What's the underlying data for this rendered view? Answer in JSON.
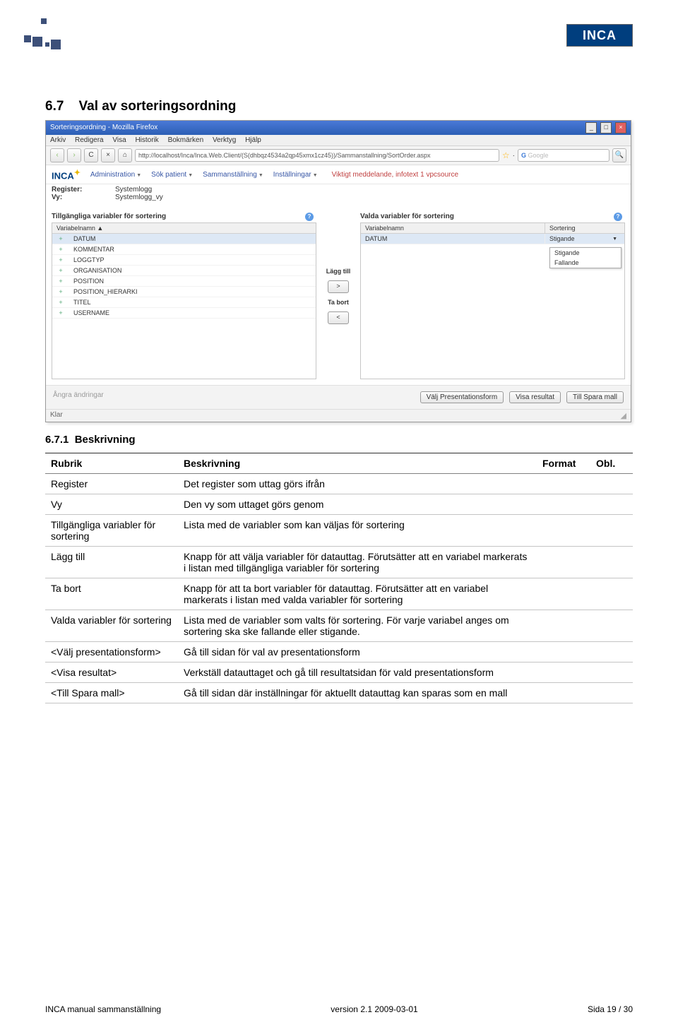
{
  "section_number": "6.7",
  "section_title": "Val av sorteringsordning",
  "subsection_number": "6.7.1",
  "subsection_title": "Beskrivning",
  "logo_text": "INCA",
  "screenshot": {
    "window_title": "Sorteringsordning - Mozilla Firefox",
    "win_min": "_",
    "win_max": "□",
    "win_close": "×",
    "menu": [
      "Arkiv",
      "Redigera",
      "Visa",
      "Historik",
      "Bokmärken",
      "Verktyg",
      "Hjälp"
    ],
    "nav_back": "‹",
    "nav_fwd": "›",
    "nav_reload": "C",
    "nav_stop": "×",
    "nav_home": "⌂",
    "url": "http://localhost/Inca/Inca.Web.Client/(S(dhbqz4534a2qp45xmx1cz45))/Sammanstallning/SortOrder.aspx",
    "star": "☆",
    "search_engine": "G",
    "search_placeholder": "Google",
    "search_go": "🔍",
    "app_logo": "INCA",
    "app_logo_star": "✦",
    "app_menu": [
      "Administration",
      "Sök patient",
      "Sammanställning",
      "Inställningar"
    ],
    "app_notice": "Viktigt meddelande, infotext 1 vpcsource",
    "meta": {
      "register_lbl": "Register:",
      "register_val": "Systemlogg",
      "vy_lbl": "Vy:",
      "vy_val": "Systemlogg_vy"
    },
    "left_panel": {
      "title": "Tillgängliga variabler för sortering",
      "header": "Variabelnamn ▲",
      "rows": [
        "DATUM",
        "KOMMENTAR",
        "LOGGTYP",
        "ORGANISATION",
        "POSITION",
        "POSITION_HIERARKI",
        "TITEL",
        "USERNAME"
      ]
    },
    "mid": {
      "add_lbl": "Lägg till",
      "add_btn": ">",
      "remove_lbl": "Ta bort",
      "remove_btn": "<"
    },
    "right_panel": {
      "title": "Valda variabler för sortering",
      "header_name": "Variabelnamn",
      "header_sort": "Sortering",
      "row_name": "DATUM",
      "row_sort": "Stigande",
      "dropdown": [
        "Stigande",
        "Fallande"
      ]
    },
    "bottom": {
      "ghost": "Ångra ändringar",
      "btn1": "Välj Presentationsform",
      "btn2": "Visa resultat",
      "btn3": "Till Spara mall"
    },
    "status": "Klar"
  },
  "table": {
    "headers": {
      "rubrik": "Rubrik",
      "beskrivning": "Beskrivning",
      "format": "Format",
      "obl": "Obl."
    },
    "rows": [
      {
        "rubrik": "Register",
        "beskrivning": "Det register som uttag görs ifrån"
      },
      {
        "rubrik": "Vy",
        "beskrivning": "Den vy som uttaget görs genom"
      },
      {
        "rubrik": "Tillgängliga variabler för sortering",
        "beskrivning": "Lista med de variabler som kan väljas för sortering"
      },
      {
        "rubrik": "Lägg till",
        "beskrivning": "Knapp för att välja variabler för datauttag. Förutsätter att en variabel markerats i listan med tillgängliga variabler för sortering"
      },
      {
        "rubrik": "Ta bort",
        "beskrivning": "Knapp för att ta bort variabler för datauttag. Förutsätter att en variabel markerats i listan med valda variabler för sortering"
      },
      {
        "rubrik": "Valda variabler för sortering",
        "beskrivning": "Lista med de variabler som valts för sortering. För varje variabel anges om sortering ska ske fallande eller stigande."
      },
      {
        "rubrik": "<Välj presentationsform>",
        "beskrivning": "Gå till sidan för val av presentationsform"
      },
      {
        "rubrik": "<Visa resultat>",
        "beskrivning": "Verkställ datauttaget och gå till resultatsidan för vald presentationsform"
      },
      {
        "rubrik": "<Till Spara mall>",
        "beskrivning": "Gå till sidan där inställningar för aktuellt datauttag kan sparas som en mall"
      }
    ]
  },
  "footer": {
    "left": "INCA manual sammanställning",
    "center": "version 2.1 2009-03-01",
    "right": "Sida 19 / 30"
  }
}
